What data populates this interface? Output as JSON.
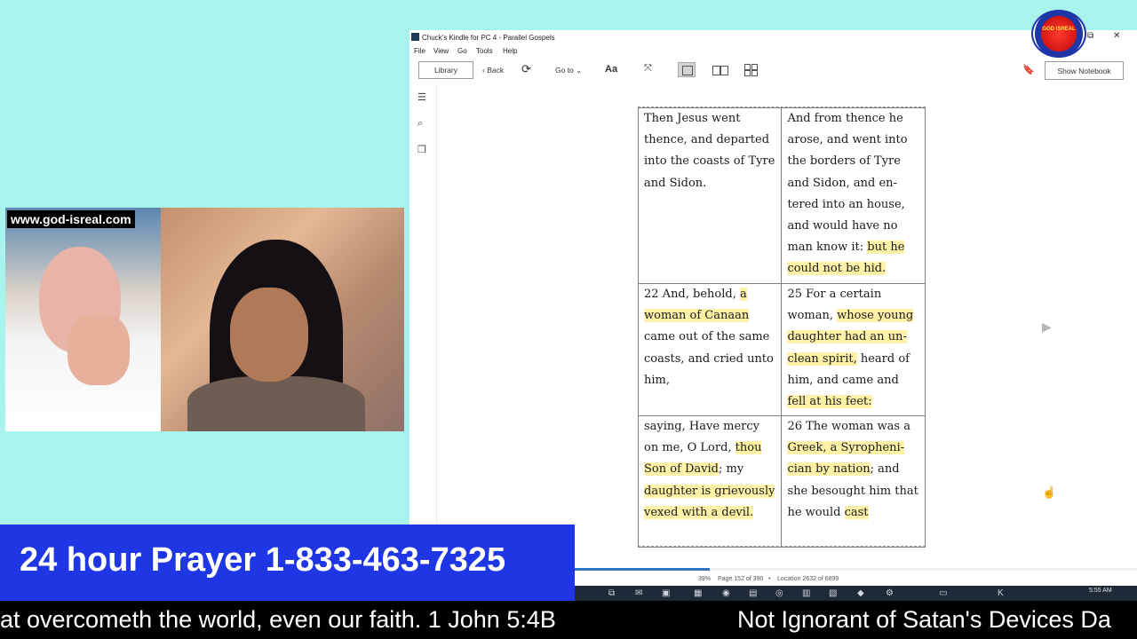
{
  "kindle": {
    "window_title": "Chuck's Kindle for PC 4 - Parallel Gospels",
    "controls": {
      "restore": "⧉",
      "close": "✕"
    },
    "menu": [
      "File",
      "View",
      "Go",
      "Tools",
      "Help"
    ],
    "toolbar": {
      "library": "Library",
      "back": "Back",
      "goto": "Go to",
      "font": "Aa",
      "show_notebook": "Show Notebook"
    },
    "table": [
      [
        [
          {
            "t": "Then Jesus went thence, and departed into the coasts of Tyre and Sidon.",
            "h": false
          }
        ],
        [
          {
            "t": "And from thence he arose, and went into the borders of Tyre and Sidon, and en­tered into an house, and would have no man know it: ",
            "h": false
          },
          {
            "t": "but he could not be hid.",
            "h": true
          }
        ]
      ],
      [
        [
          {
            "t": "22 And, behold, ",
            "h": false
          },
          {
            "t": "a woman of Canaan",
            "h": true
          },
          {
            "t": " came out of the same coasts, and cried unto him,",
            "h": false
          }
        ],
        [
          {
            "t": "25 For a certain woman, ",
            "h": false
          },
          {
            "t": "whose young daughter had an un­clean spirit,",
            "h": true
          },
          {
            "t": " heard of him, and came and ",
            "h": false
          },
          {
            "t": "fell at his feet:",
            "h": true
          }
        ]
      ],
      [
        [
          {
            "t": "saying, Have mercy on me, O Lord, ",
            "h": false
          },
          {
            "t": "thou Son of David",
            "h": true
          },
          {
            "t": "; my ",
            "h": false
          },
          {
            "t": "daughter is griev­ously vexed with a devil.",
            "h": true
          }
        ],
        [
          {
            "t": "26  The woman was a ",
            "h": false
          },
          {
            "t": "Greek, a Syropheni­cian by nation",
            "h": true
          },
          {
            "t": "; and she besought him that he would ",
            "h": false
          },
          {
            "t": "cast",
            "h": true
          }
        ]
      ]
    ],
    "status": {
      "percent": "39%",
      "page": "Page 152 of 390",
      "separator": "•",
      "location": "Location 2632 of 6899",
      "progress": 0.39
    },
    "logo_text": "GOD ISREAL"
  },
  "webcam": {
    "url": "www.god-isreal.com"
  },
  "prayer_banner": "24 hour Prayer 1-833-463-7325",
  "taskbar": {
    "time": "5:55 AM"
  },
  "ticker": {
    "left": "at overcometh the world, even our faith. 1 John 5:4B",
    "right": "Not Ignorant of Satan's Devices Da"
  }
}
